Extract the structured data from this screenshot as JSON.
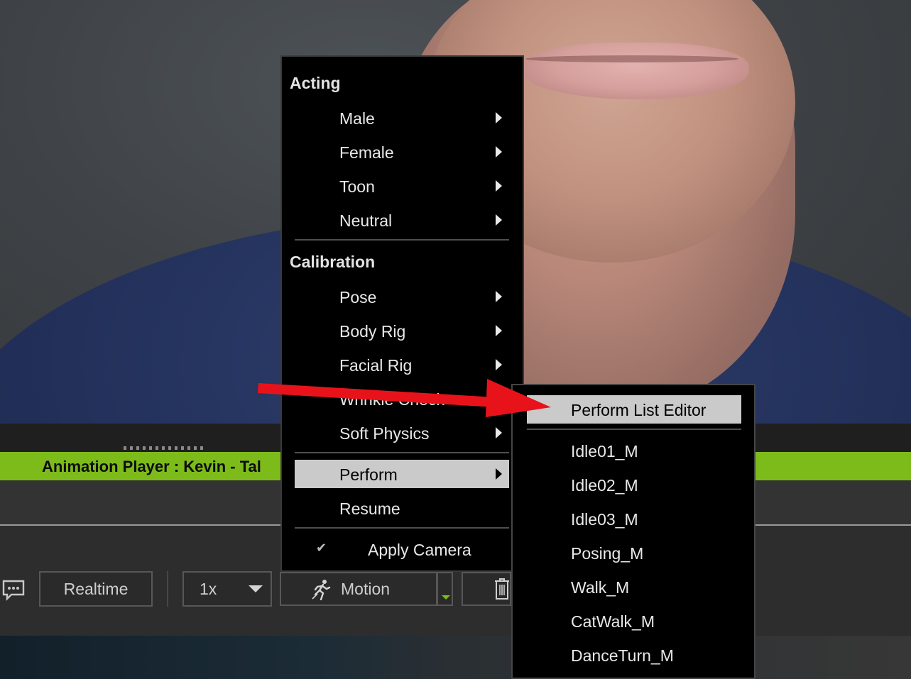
{
  "player": {
    "title": "Animation Player : Kevin - Tal"
  },
  "controls": {
    "realtime_label": "Realtime",
    "speed_value": "1x",
    "motion_label": "Motion",
    "accent_color": "#7dbb1a"
  },
  "main_menu": {
    "sections": [
      {
        "header": "Acting",
        "items": [
          "Male",
          "Female",
          "Toon",
          "Neutral"
        ]
      },
      {
        "header": "Calibration",
        "items": [
          "Pose",
          "Body Rig",
          "Facial Rig",
          "Wrinkle Check",
          "Soft Physics"
        ]
      }
    ],
    "perform": "Perform",
    "resume": "Resume",
    "apply_camera": "Apply Camera",
    "apply_camera_checked": true
  },
  "sub_menu": {
    "editor": "Perform List Editor",
    "items": [
      "Idle01_M",
      "Idle02_M",
      "Idle03_M",
      "Posing_M",
      "Walk_M",
      "CatWalk_M",
      "DanceTurn_M"
    ]
  },
  "annotation": {
    "arrow_color": "#e8131a"
  }
}
